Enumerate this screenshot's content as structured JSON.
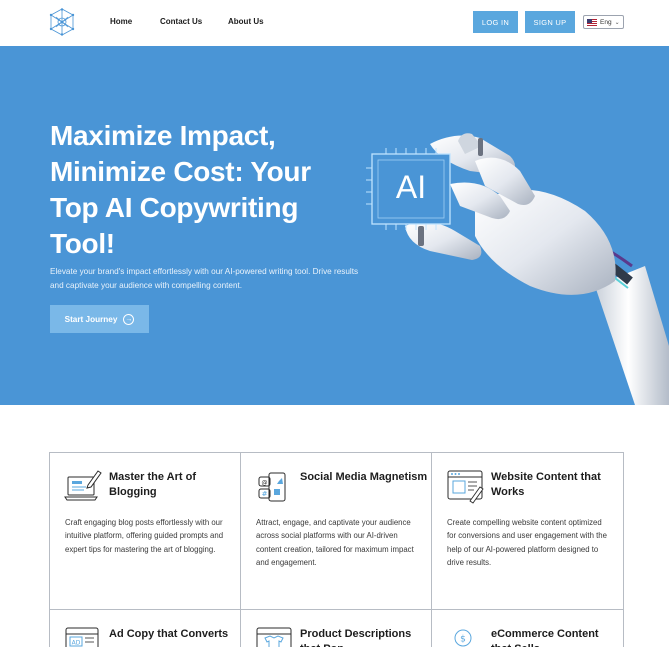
{
  "header": {
    "nav": [
      "Home",
      "Contact Us",
      "About Us"
    ],
    "login_label": "LOG IN",
    "signup_label": "SIGN UP",
    "language": "Eng"
  },
  "hero": {
    "title": "Maximize Impact, Minimize Cost: Your Top AI Copywriting Tool!",
    "subtitle": "Elevate your brand's impact effortlessly with our AI-powered writing tool. Drive results and captivate your audience with compelling content.",
    "cta_label": "Start Journey",
    "chip_text": "AI"
  },
  "features": [
    {
      "title": "Master the Art of Blogging",
      "desc": "Craft engaging blog posts effortlessly with our intuitive platform, offering guided prompts and expert tips for mastering the art of blogging.",
      "icon": "blog-laptop-icon"
    },
    {
      "title": "Social Media Magnetism",
      "desc": "Attract, engage, and captivate your audience across social platforms with our AI-driven content creation, tailored for maximum impact and engagement.",
      "icon": "social-media-icon"
    },
    {
      "title": "Website Content that Works",
      "desc": "Create compelling website content optimized for conversions and user engagement with the help of our AI-powered platform designed to drive results.",
      "icon": "website-content-icon"
    },
    {
      "title": "Ad Copy that Converts",
      "desc": "",
      "icon": "ad-copy-icon"
    },
    {
      "title": "Product Descriptions that Pop",
      "desc": "",
      "icon": "product-description-icon"
    },
    {
      "title": "eCommerce Content that Sells",
      "desc": "",
      "icon": "ecommerce-icon"
    }
  ],
  "colors": {
    "hero_bg": "#4a95d6",
    "button_blue": "#5aa7de",
    "cta_bg": "#7ab8e8",
    "icon_blue": "#3f8fd3"
  }
}
